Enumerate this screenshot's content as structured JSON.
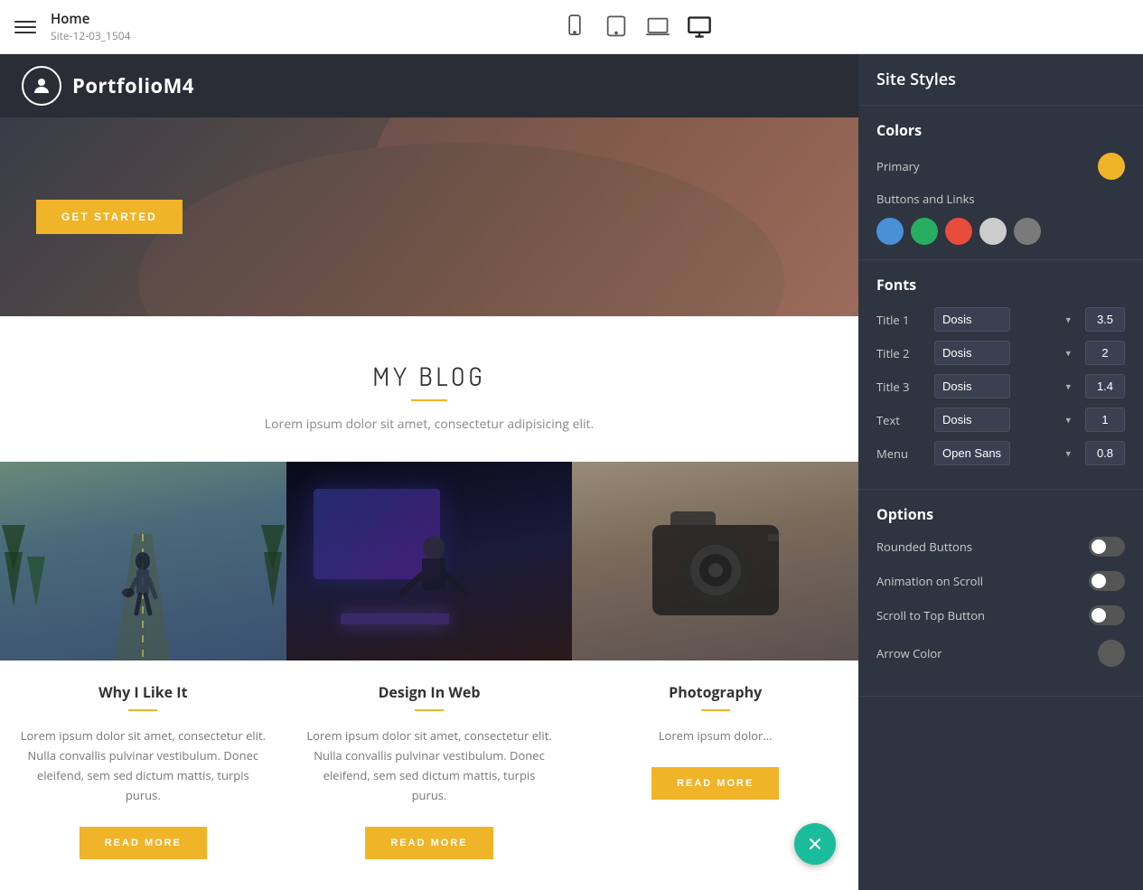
{
  "topbar": {
    "page_title": "Home",
    "site_id": "Site-12-03_1504"
  },
  "panel": {
    "title": "Site Styles",
    "colors_section": "Colors",
    "primary_label": "Primary",
    "primary_color": "#f0b429",
    "buttons_links_label": "Buttons and Links",
    "button_colors": [
      "#4a90d9",
      "#27ae60",
      "#e74c3c",
      "#cccccc",
      "#7a7a7a"
    ],
    "fonts_section": "Fonts",
    "font_rows": [
      {
        "label": "Title 1",
        "font": "Dosis",
        "size": "3.5"
      },
      {
        "label": "Title 2",
        "font": "Dosis",
        "size": "2"
      },
      {
        "label": "Title 3",
        "font": "Dosis",
        "size": "1.4"
      },
      {
        "label": "Text",
        "font": "Dosis",
        "size": "1"
      },
      {
        "label": "Menu",
        "font": "Open Sans",
        "size": "0.8"
      }
    ],
    "options_section": "Options",
    "option_rows": [
      {
        "label": "Rounded Buttons",
        "enabled": false
      },
      {
        "label": "Animation on Scroll",
        "enabled": false
      },
      {
        "label": "Scroll to Top Button",
        "enabled": false
      },
      {
        "label": "Arrow Color",
        "type": "color"
      }
    ]
  },
  "nav": {
    "logo_text": "PortfolioM4"
  },
  "hero": {
    "btn_label": "GET STARTED"
  },
  "blog": {
    "heading": "MY BLOG",
    "subtitle": "Lorem ipsum dolor sit amet, consectetur adipisicing elit.",
    "cards": [
      {
        "title": "Why I Like It",
        "text": "Lorem ipsum dolor sit amet, consectetur elit. Nulla convallis pulvinar vestibulum. Donec eleifend, sem sed dictum mattis, turpis purus.",
        "btn": "READ MORE",
        "img_type": "road"
      },
      {
        "title": "Design In Web",
        "text": "Lorem ipsum dolor sit amet, consectetur elit. Nulla convallis pulvinar vestibulum. Donec eleifend, sem sed dictum mattis, turpis purus.",
        "btn": "READ MORE",
        "img_type": "tech"
      },
      {
        "title": "Photography",
        "text": "Lorem ipsum dolor...",
        "btn": "READ MORE",
        "img_type": "camera"
      }
    ]
  }
}
